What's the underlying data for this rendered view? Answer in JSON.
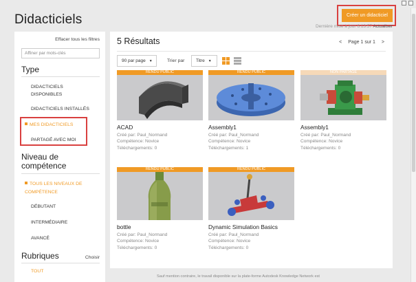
{
  "page": {
    "title": "Didacticiels",
    "create_button": "Créer un didacticiel",
    "update_text": "Dernière mise à jour 6:13:57",
    "refresh_label": "Actualiser",
    "footer_text": "Sauf mention contraire, le travail disponible sur la plate-forme Autodesk Knowledge Network est"
  },
  "sidebar": {
    "clear_filters": "Effacer tous les filtres",
    "keyword_placeholder": "Affiner par mots-clés",
    "type_title": "Type",
    "type_items": [
      {
        "label": "DIDACTICIELS DISPONIBLES",
        "active": false
      },
      {
        "label": "DIDACTICIELS INSTALLÉS",
        "active": false
      },
      {
        "label": "MES DIDACTICIELS",
        "active": true
      },
      {
        "label": "PARTAGÉ AVEC MOI",
        "active": false
      }
    ],
    "level_title": "Niveau de compétence",
    "level_items": [
      {
        "label": "TOUS LES NIVEAUX DE COMPÉTENCE",
        "active": true
      },
      {
        "label": "DÉBUTANT",
        "active": false
      },
      {
        "label": "INTERMÉDIAIRE",
        "active": false
      },
      {
        "label": "AVANCÉ",
        "active": false
      }
    ],
    "topics_title": "Rubriques",
    "topics_choose": "Choisir",
    "topics_items": [
      {
        "label": "TOUT",
        "active": true
      }
    ]
  },
  "main": {
    "results_title": "5 Résultats",
    "pager": {
      "prev": "<",
      "label": "Page 1 sur 1",
      "next": ">"
    },
    "per_page": "90 par page",
    "sort_label": "Trier par",
    "sort_value": "Titre",
    "cards": [
      {
        "badge": "RENDU PUBLIC",
        "badge_type": "public",
        "thumb": "acad",
        "title": "ACAD",
        "creator": "Créé par: Paul_Normand",
        "skill": "Compétence: Novice",
        "downloads": "Téléchargements: 0"
      },
      {
        "badge": "RENDU PUBLIC",
        "badge_type": "public",
        "thumb": "assembly-disc",
        "title": "Assembly1",
        "creator": "Créé par: Paul_Normand",
        "skill": "Compétence: Novice",
        "downloads": "Téléchargements: 1"
      },
      {
        "badge": "NON PARTAGÉ",
        "badge_type": "private",
        "thumb": "assembly-gearbox",
        "title": "Assembly1",
        "creator": "Créé par: Paul_Normand",
        "skill": "Compétence: Novice",
        "downloads": "Téléchargements: 0"
      },
      {
        "badge": "RENDU PUBLIC",
        "badge_type": "public",
        "thumb": "bottle",
        "title": "bottle",
        "creator": "Créé par: Paul_Normand",
        "skill": "Compétence: Novice",
        "downloads": "Téléchargements: 0"
      },
      {
        "badge": "RENDU PUBLIC",
        "badge_type": "public",
        "thumb": "catapult",
        "title": "Dynamic Simulation Basics",
        "creator": "Créé par: Paul_Normand",
        "skill": "Compétence: Novice",
        "downloads": "Téléchargements: 0"
      }
    ]
  },
  "colors": {
    "accent": "#f09a25",
    "highlight_box": "#d9403f"
  }
}
